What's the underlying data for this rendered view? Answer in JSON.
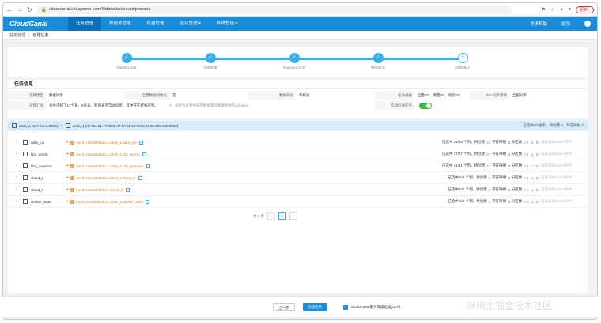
{
  "browser": {
    "url": "cloudcanal.clougence.com/#/data/job/create/process",
    "update_label": "更新 :"
  },
  "app": {
    "logo": "CloudCanal",
    "menu": [
      "任务管理",
      "数据源管理",
      "机器管理",
      "监控管理 ▾",
      "系统管理 ▾"
    ],
    "help": "寻求帮助",
    "user": "励强"
  },
  "breadcrumb": [
    "任务管理",
    "创建任务"
  ],
  "steps": [
    {
      "label": "源&目标设置"
    },
    {
      "label": "功能配置"
    },
    {
      "label": "表&action过滤"
    },
    {
      "label": "数据处理"
    },
    {
      "label": "创建确认",
      "number": "5"
    }
  ],
  "task_info": {
    "title": "任务信息",
    "fields": [
      {
        "k": "迁移类型",
        "v": "数据同步"
      },
      {
        "k": "全量数据初始化",
        "v": "是"
      },
      {
        "k": "数据校验",
        "v": "不校验"
      },
      {
        "k": "任务规格",
        "v": "全量2G、增量2G、校验2G"
      },
      {
        "k": "DDL同步策略",
        "v": "全部同步"
      },
      {
        "k": "迁移汇总",
        "v": "总共选择了17个表，6张表，新增表不自动同步，其中存在结构迁移。"
      },
      {
        "k": "自动启动任务",
        "v": ""
      }
    ],
    "hint": "3：表结构迁移将按照数据库对象源对象的collation"
  },
  "source_bar": {
    "src": "dnds_1",
    "src_addr": "(127.0.0.1:3306)",
    "dst": "dnds_1",
    "dst_addr": "(47.111.61.77:9093,47.97.91.26:9093,47.98.125.140:9093)",
    "summary": "已选中6/6张表，待创建 6，存在映射 0"
  },
  "tables": [
    {
      "name": "data_job",
      "target": "my-51c9e5a484dcc1.dnds_1.data_job",
      "stat": "已选中 34/34 个列，待创建",
      "n1": "34",
      "n2": "0",
      "n3": "0"
    },
    {
      "name": "kbs_article",
      "target": "my-51c9e5a484dcc1.dnds_1.kbs_article",
      "stat": "已选中 37/37 个列，待创建",
      "n1": "37",
      "n2": "0",
      "n3": "0"
    },
    {
      "name": "kbs_question",
      "target": "my-51c9e5a484dcc1.dnds_1.kbs_question",
      "stat": "已选中 41/41 个列，待创建",
      "n1": "41",
      "n2": "0",
      "n3": "0"
    },
    {
      "name": "shard_0",
      "target": "my-51c9e5a484dcc1.dnds_1.shard_0",
      "stat": "已选中 5/5 个列，待创建",
      "n1": "5",
      "n2": "0",
      "n3": "0"
    },
    {
      "name": "shard_1",
      "target": "my-51c9e5a484dcc1.shard_1",
      "stat": "已选中 5/5 个列，待创建",
      "n1": "5",
      "n2": "0",
      "n3": "0"
    },
    {
      "name": "worker_stats",
      "target": "my-51e2e5ad84dcc1.dnds_1.worker_stats",
      "stat": "已选中 6/6 个列，待创建",
      "n1": "6",
      "n2": "0",
      "n3": "0"
    }
  ],
  "row_labels": {
    "mapped": "存在映射",
    "shard": "分区数",
    "iud": "I U D",
    "extra": "设置表级action条件"
  },
  "pager": {
    "total": "共 6 条",
    "current": "1"
  },
  "footer": {
    "prev": "上一步",
    "create": "创建任务",
    "sla": "CloudCanal服务等级协议(SLA)"
  },
  "watermark": "@稀土掘金技术社区"
}
